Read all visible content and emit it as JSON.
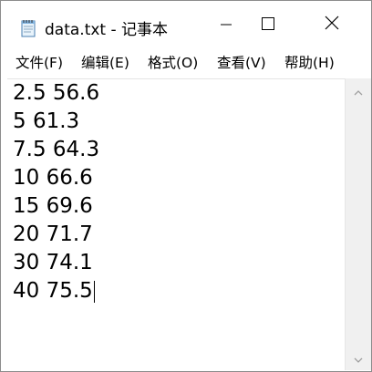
{
  "window": {
    "title": "data.txt - 记事本"
  },
  "menu": {
    "items": [
      {
        "label": "文件(F)"
      },
      {
        "label": "编辑(E)"
      },
      {
        "label": "格式(O)"
      },
      {
        "label": "查看(V)"
      },
      {
        "label": "帮助(H)"
      }
    ]
  },
  "editor": {
    "lines": [
      "2.5 56.6",
      "5 61.3",
      "7.5 64.3",
      "10 66.6",
      "15 69.6",
      "20 71.7",
      "30 74.1",
      "40 75.5"
    ]
  },
  "icons": {
    "app": "notepad-icon",
    "minimize": "minimize-icon",
    "maximize": "maximize-icon",
    "close": "close-icon",
    "scroll_up": "chevron-up-icon",
    "scroll_down": "chevron-down-icon"
  },
  "colors": {
    "window_bg": "#ffffff",
    "border": "#8c8c8c",
    "scrollbar_bg": "#f0f0f0",
    "icon_gray": "#9a9a9a"
  }
}
